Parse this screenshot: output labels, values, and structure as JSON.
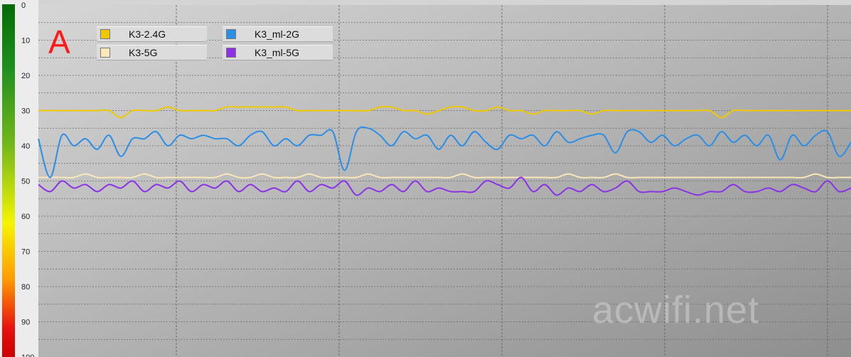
{
  "panel_label": "A",
  "watermark": "acwifi.net",
  "chart_data": {
    "type": "line",
    "ylim": [
      0,
      100
    ],
    "y_inverted": true,
    "y_ticks": [
      "0",
      "10",
      "20",
      "30",
      "40",
      "50",
      "60",
      "70",
      "80",
      "90",
      "100"
    ],
    "grid": true,
    "legend_position": "top-left",
    "series": [
      {
        "name": "K3-2.4G",
        "color": "#f0c800",
        "values": [
          30,
          30,
          30,
          30,
          30,
          30,
          30,
          32,
          30,
          30,
          30,
          29,
          30,
          30,
          30,
          30,
          29,
          29,
          29,
          29,
          29,
          29,
          30,
          30,
          30,
          30,
          30,
          30,
          30,
          29,
          29,
          30,
          30,
          31,
          30,
          29,
          29,
          30,
          30,
          29,
          30,
          30,
          31,
          30,
          30,
          30,
          30,
          31,
          30,
          30,
          30,
          30,
          30,
          30,
          30,
          30,
          30,
          30,
          32,
          30,
          30,
          30,
          30,
          30,
          30,
          30,
          30,
          30,
          30,
          30
        ]
      },
      {
        "name": "K3_ml-2G",
        "color": "#2b8fe8",
        "values": [
          38,
          49,
          37,
          40,
          38,
          41,
          37,
          43,
          38,
          38,
          36,
          40,
          37,
          38,
          37,
          38,
          38,
          40,
          37,
          36,
          40,
          38,
          40,
          37,
          37,
          36,
          47,
          36,
          35,
          37,
          40,
          36,
          38,
          37,
          41,
          37,
          40,
          36,
          39,
          41,
          37,
          38,
          37,
          40,
          36,
          39,
          38,
          37,
          37,
          42,
          36,
          36,
          39,
          37,
          40,
          38,
          37,
          40,
          36,
          39,
          37,
          40,
          37,
          44,
          37,
          40,
          37,
          36,
          43,
          39
        ]
      },
      {
        "name": "K3-5G",
        "color": "#fde7b8",
        "values": [
          49,
          49,
          49,
          49,
          48,
          49,
          49,
          49,
          49,
          48,
          49,
          49,
          49,
          49,
          49,
          49,
          48,
          49,
          49,
          48,
          49,
          49,
          49,
          48,
          49,
          49,
          49,
          49,
          48,
          49,
          49,
          49,
          49,
          49,
          49,
          49,
          48,
          49,
          49,
          49,
          49,
          49,
          49,
          49,
          49,
          48,
          49,
          49,
          49,
          48,
          49,
          49,
          49,
          49,
          49,
          49,
          49,
          49,
          49,
          49,
          49,
          49,
          49,
          49,
          49,
          49,
          48,
          49,
          49,
          49
        ]
      },
      {
        "name": "K3_ml-5G",
        "color": "#8c32e6",
        "values": [
          51,
          53,
          50,
          52,
          51,
          53,
          51,
          52,
          50,
          53,
          51,
          52,
          50,
          53,
          51,
          52,
          50,
          53,
          51,
          53,
          52,
          53,
          50,
          53,
          51,
          52,
          50,
          54,
          52,
          53,
          51,
          53,
          50,
          53,
          52,
          53,
          53,
          53,
          50,
          51,
          52,
          49,
          53,
          51,
          54,
          52,
          53,
          51,
          53,
          52,
          50,
          53,
          53,
          53,
          52,
          53,
          54,
          53,
          53,
          51,
          53,
          53,
          52,
          53,
          51,
          52,
          53,
          50,
          53,
          52
        ]
      }
    ]
  }
}
